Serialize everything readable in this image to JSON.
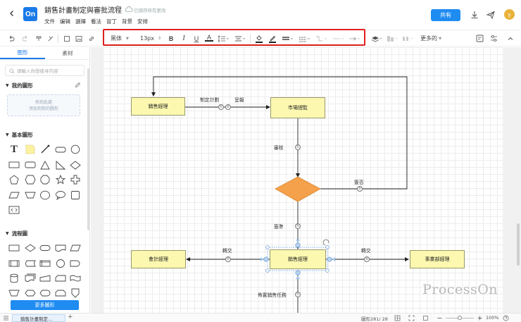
{
  "header": {
    "logo": "On",
    "title": "銷售計畫制定與審批流程",
    "saved_status": "已儲存所有更改",
    "share_label": "共有",
    "avatar_letter": "y"
  },
  "menu": [
    "文件",
    "编辑",
    "選擇",
    "看法",
    "冒丁",
    "背景",
    "安排"
  ],
  "toolbar": {
    "font_family": "黑体",
    "font_size": "13px",
    "more_label": "更多的"
  },
  "sidebar": {
    "tabs": [
      "图形",
      "素材"
    ],
    "search_placeholder": "请輸入你想搜寻内容",
    "my_shapes_title": "我的圖形",
    "my_shapes_hint_line1": "拖到此處",
    "my_shapes_hint_line2": "添加到我的圖形",
    "basic_title": "基本圖形",
    "flow_title": "流程圖",
    "more_shapes": "更多圖形"
  },
  "diagram": {
    "nodes": {
      "sales_manager_top": "銷售經理",
      "market_director": "市場總監",
      "accountant": "會計經理",
      "sales_manager_mid": "銷售經理",
      "department_manager": "事業部經理"
    },
    "edges": {
      "formulate_plan": "制定計劃",
      "submit": "呈報",
      "review": "審核",
      "not_approved": "簽否",
      "approved": "簽準",
      "submit_left": "轉交",
      "submit_right": "轉交",
      "decompose": "佈置銷售任務"
    },
    "numbers": {
      "n1": "①",
      "n2": "②"
    }
  },
  "watermark": "ProcessOn",
  "status": {
    "page_tab": "銷售計畫制定…",
    "add": "+",
    "shape_count": "圖形281/ 28",
    "zoom": "100%"
  },
  "colors": {
    "accent": "#1f8cf2",
    "node_fill": "#fdf8b0",
    "decision_fill": "#f5a04a",
    "highlight": "#e02020"
  }
}
